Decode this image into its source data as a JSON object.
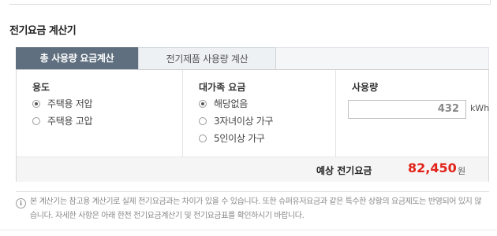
{
  "title": "전기요금 계산기",
  "tabs": [
    {
      "label": "총 사용량 요금계산",
      "active": true
    },
    {
      "label": "전기제품 사용량 계산",
      "active": false
    }
  ],
  "usage_type": {
    "title": "용도",
    "options": [
      {
        "label": "주택용 저압",
        "selected": true
      },
      {
        "label": "주택용 고압",
        "selected": false
      }
    ]
  },
  "family_rate": {
    "title": "대가족 요금",
    "options": [
      {
        "label": "해당없음",
        "selected": true
      },
      {
        "label": "3자녀이상 가구",
        "selected": false
      },
      {
        "label": "5인이상 가구",
        "selected": false
      }
    ]
  },
  "usage": {
    "title": "사용량",
    "value": "432",
    "unit": "kWh"
  },
  "result": {
    "label": "예상 전기요금",
    "value": "82,450",
    "unit": "원"
  },
  "notice": {
    "icon": "info-icon",
    "text": "본 계산기는 참고용 계산기로 실제 전기요금과는 차이가 있을 수 있습니다. 또한 슈퍼유저요금과 같은 특수한 상황의 요금제도는 반영되어 있지 않습니다. 자세한 사항은 아래 한전 전기요금계산기 및 전기요금표를 확인하시기 바랍니다."
  },
  "colors": {
    "active_tab": "#5f6f7f",
    "result_value": "#e2231a"
  }
}
